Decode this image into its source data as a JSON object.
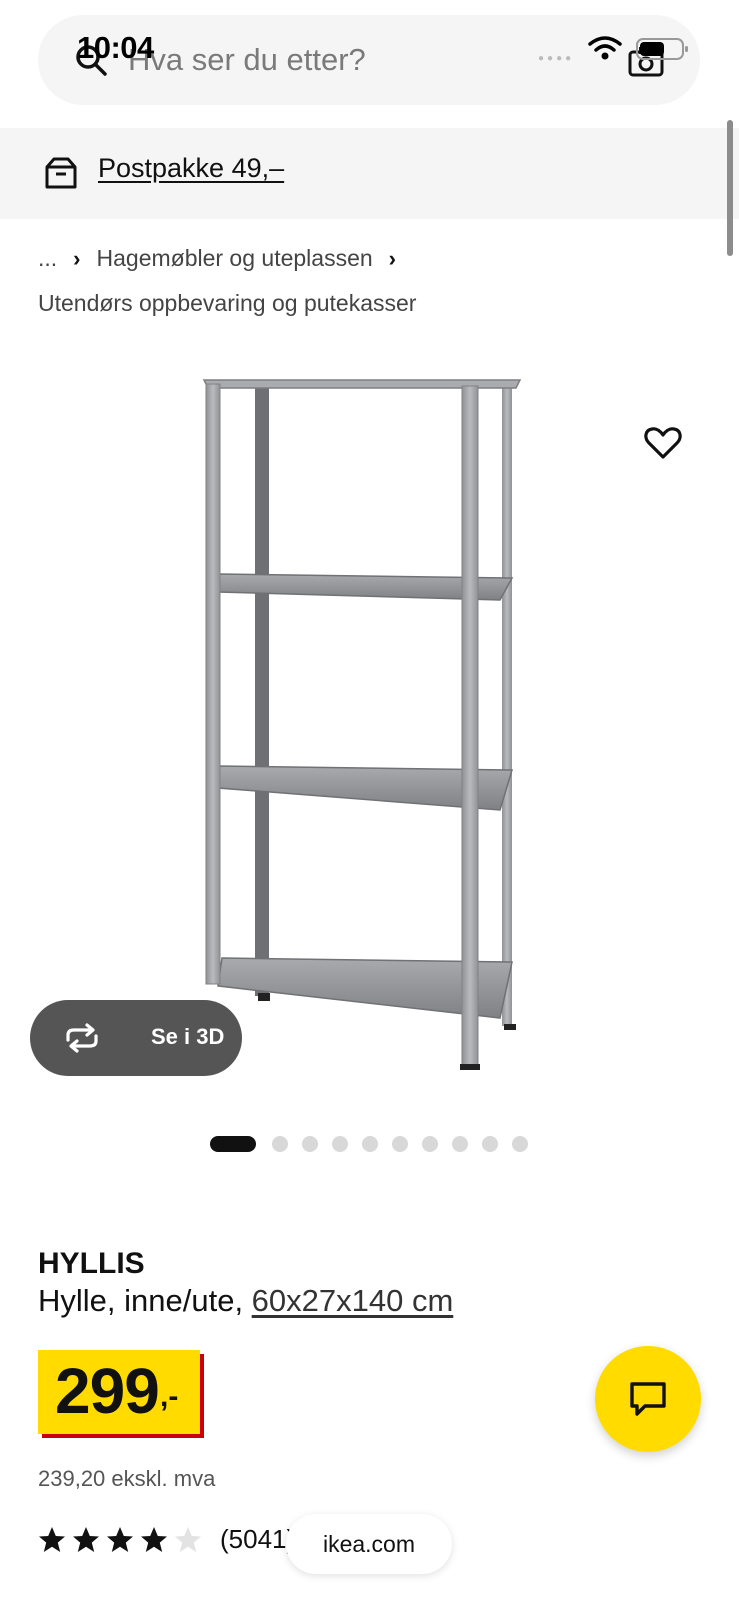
{
  "status_bar": {
    "time": "10:04"
  },
  "search": {
    "placeholder": "Hva ser du etter?"
  },
  "shipping": {
    "label": "Postpakke 49,–"
  },
  "breadcrumb": {
    "items": [
      "...",
      "Hagemøbler og uteplassen"
    ],
    "current": "Utendørs oppbevaring og putekasser"
  },
  "gallery": {
    "view_3d_label": "Se i 3D",
    "image_count": 10,
    "active_index": 0
  },
  "product": {
    "name": "HYLLIS",
    "description_prefix": "Hylle, inne/ute, ",
    "dimensions": "60x27x140 cm",
    "price_integer": "299",
    "price_suffix": ",-",
    "price_ex_vat": "239,20 ekskl. mva",
    "rating": 4,
    "rating_max": 5,
    "review_count": "(5041)"
  },
  "browser": {
    "url": "ikea.com"
  },
  "colors": {
    "brand_yellow": "#ffdb00",
    "brand_red": "#cc0008"
  }
}
